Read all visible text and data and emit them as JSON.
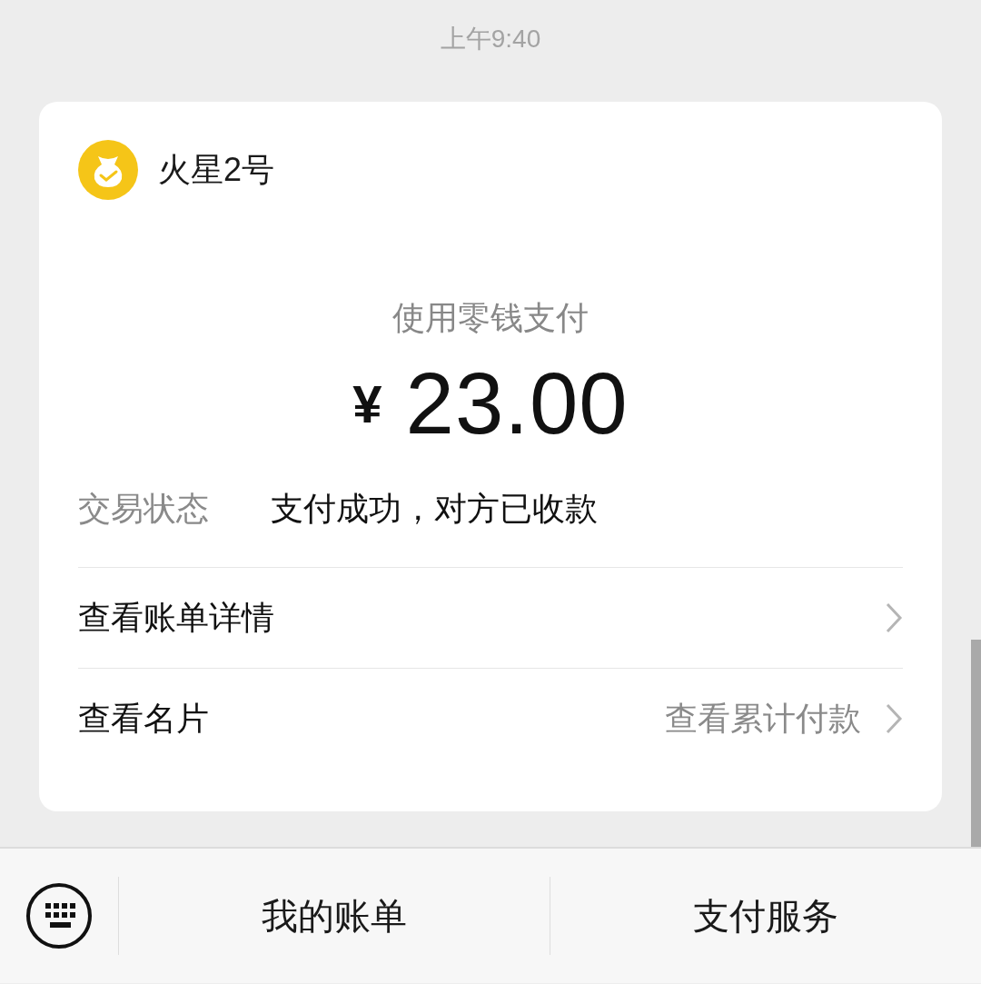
{
  "time": "上午9:40",
  "card": {
    "merchant": "火星2号",
    "method": "使用零钱支付",
    "currency": "¥",
    "amount": "23.00",
    "status_label": "交易状态",
    "status_value": "支付成功，对方已收款",
    "rows": [
      {
        "label": "查看账单详情"
      },
      {
        "label": "查看名片",
        "extra": "查看累计付款"
      }
    ]
  },
  "bottom_bar": {
    "buttons": [
      "我的账单",
      "支付服务"
    ]
  }
}
